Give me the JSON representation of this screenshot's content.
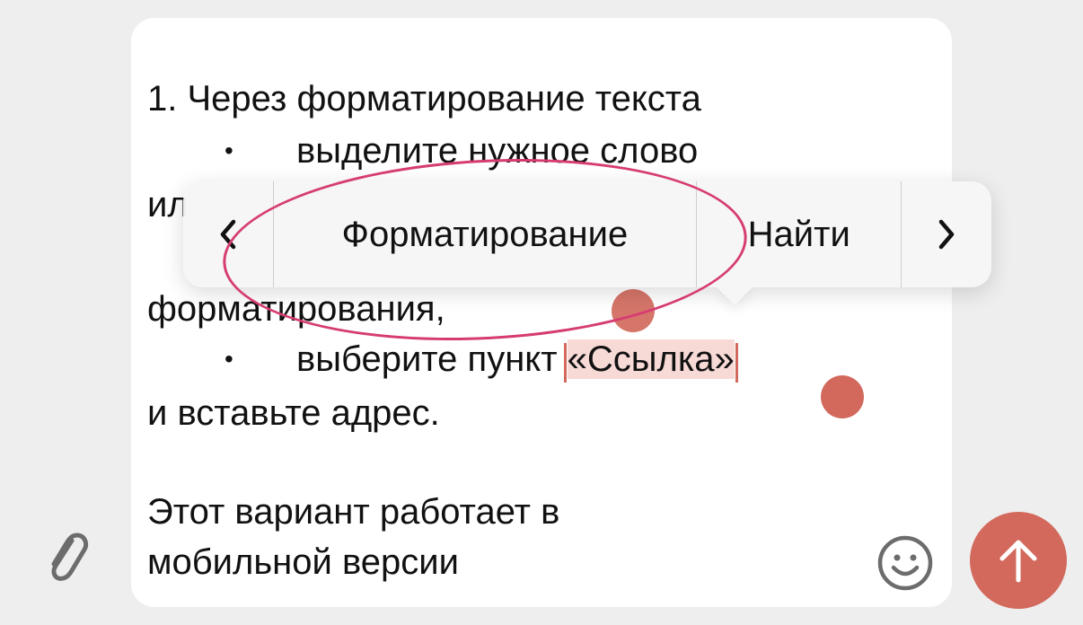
{
  "composer": {
    "lines": {
      "heading": "1. Через форматирование текста",
      "bullet1": "выделите нужное слово",
      "hidden_fragment": "ил",
      "line_format": "форматирования,",
      "bullet2_prefix": "выберите пункт ",
      "bullet2_selected": "«Ссылка»",
      "line_insert": "и вставьте адрес.",
      "para2_line1": "Этот вариант работает в",
      "para2_line2": "мобильной версии"
    },
    "bullet_symbol": "•"
  },
  "context_menu": {
    "prev": "‹",
    "formatting": "Форматирование",
    "find": "Найти",
    "next": "›"
  },
  "icons": {
    "attach": "paperclip-icon",
    "emoji": "smiley-icon",
    "send": "arrow-up-icon"
  },
  "colors": {
    "accent": "#d2695c",
    "annotation": "#d63c72",
    "selection": "#f7d9d6"
  }
}
